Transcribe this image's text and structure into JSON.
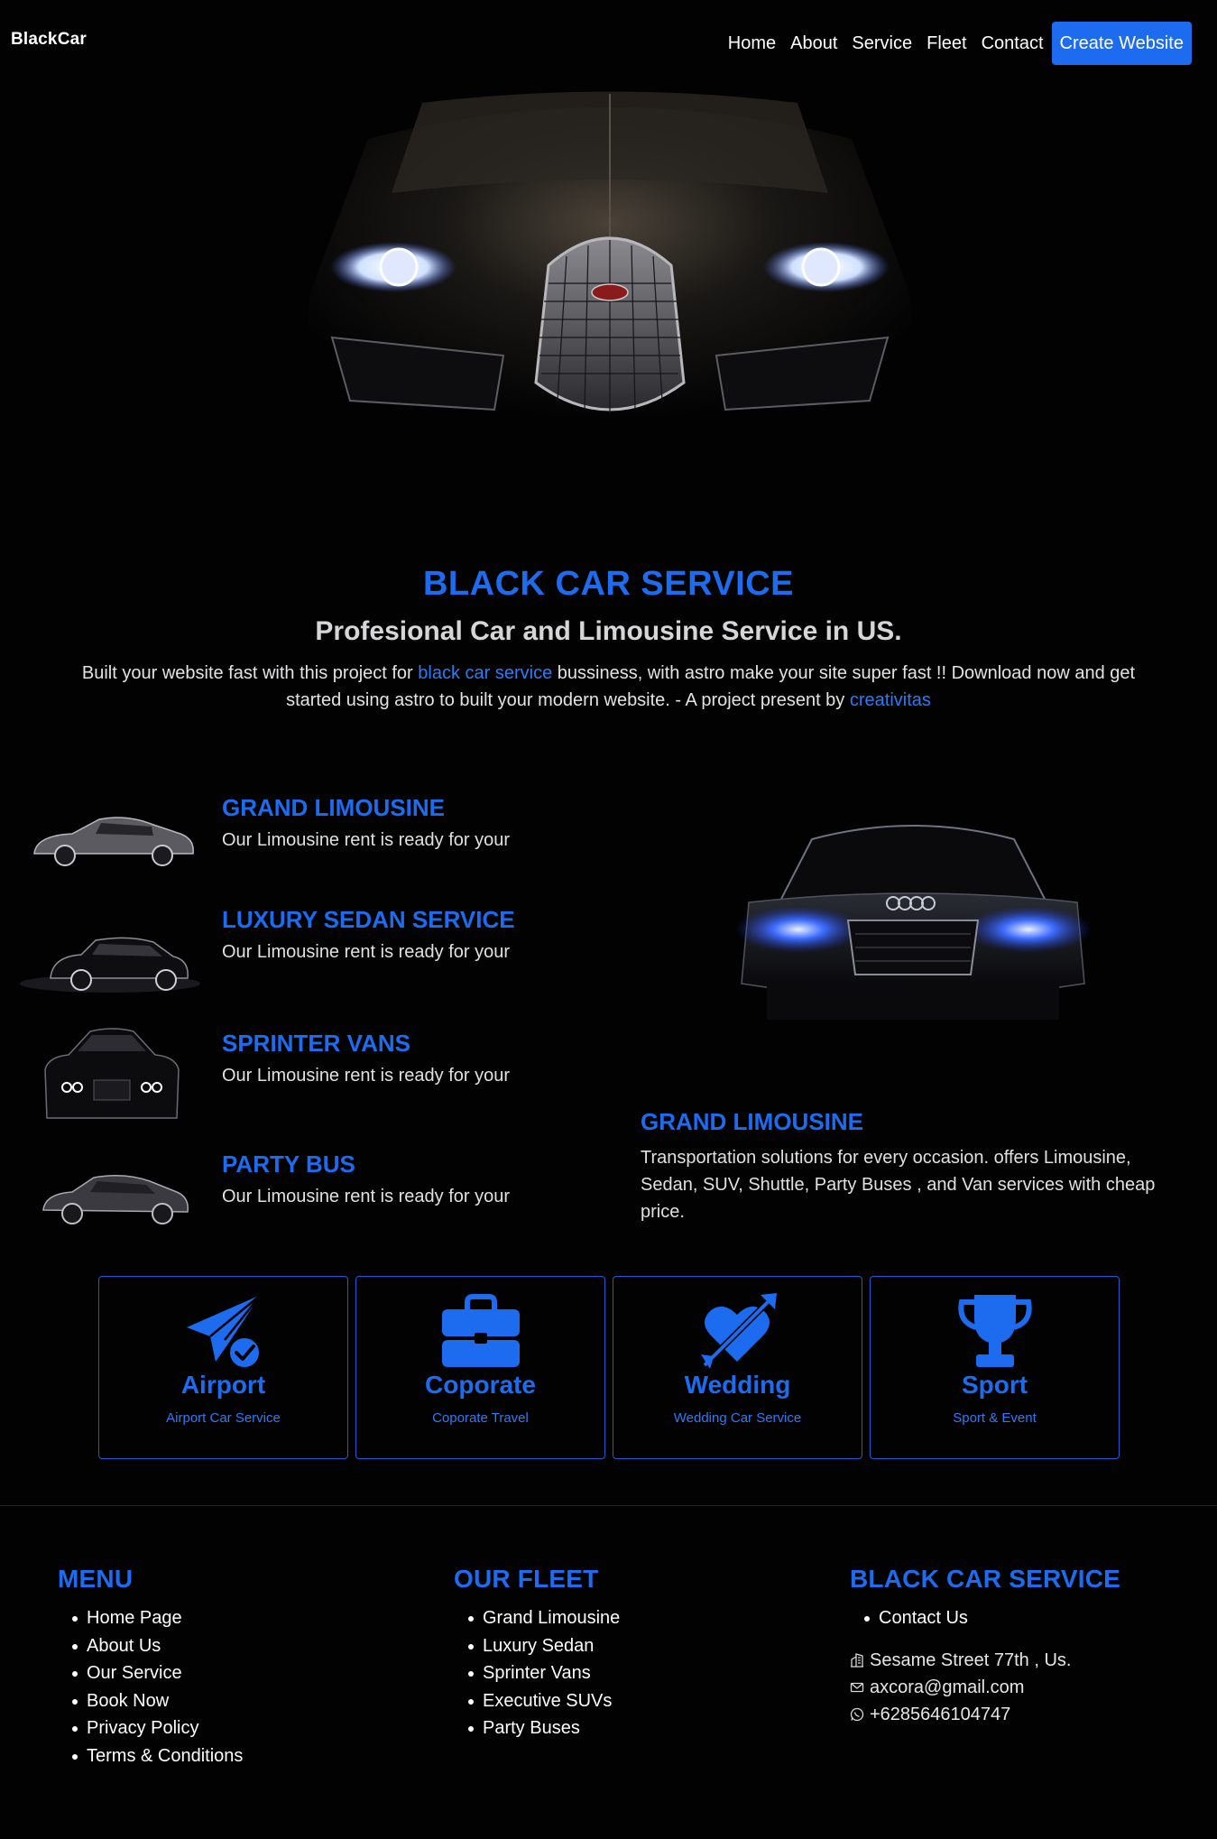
{
  "header": {
    "logo": "BlackCar",
    "nav": [
      "Home",
      "About",
      "Service",
      "Fleet",
      "Contact"
    ],
    "cta": "Create Website"
  },
  "hero": {
    "title": "BLACK CAR SERVICE",
    "subtitle": "Profesional Car and Limousine Service in US.",
    "desc_pre": "Built your website fast with this project for ",
    "desc_link1": "black car service",
    "desc_mid": " bussiness, with astro make your site super fast !! Download now and get started using astro to built your modern website. - A project present by ",
    "desc_link2": "creativitas"
  },
  "fleet": [
    {
      "title": "GRAND LIMOUSINE",
      "text": "Our Limousine rent is ready for your"
    },
    {
      "title": "LUXURY SEDAN SERVICE",
      "text": "Our Limousine rent is ready for your"
    },
    {
      "title": "SPRINTER VANS",
      "text": "Our Limousine rent is ready for your"
    },
    {
      "title": "PARTY BUS",
      "text": "Our Limousine rent is ready for your"
    }
  ],
  "feature": {
    "title": "GRAND LIMOUSINE",
    "text": "Transportation solutions for every occasion. offers Limousine, Sedan, SUV, Shuttle, Party Buses , and Van services with cheap price."
  },
  "services": [
    {
      "title": "Airport",
      "sub": "Airport Car Service",
      "icon": "paper-plane-check-icon"
    },
    {
      "title": "Coporate",
      "sub": "Coporate Travel",
      "icon": "briefcase-icon"
    },
    {
      "title": "Wedding",
      "sub": "Wedding Car Service",
      "icon": "heart-arrow-icon"
    },
    {
      "title": "Sport",
      "sub": "Sport & Event",
      "icon": "trophy-icon"
    }
  ],
  "footer": {
    "menu_title": "MENU",
    "menu": [
      "Home Page",
      "About Us",
      "Our Service",
      "Book Now",
      "Privacy Policy",
      "Terms & Conditions"
    ],
    "fleet_title": "OUR FLEET",
    "fleet": [
      "Grand Limousine",
      "Luxury Sedan",
      "Sprinter Vans",
      "Executive SUVs",
      "Party Buses"
    ],
    "company_title": "BLACK CAR SERVICE",
    "company": [
      "Contact Us"
    ],
    "address": "Sesame Street 77th , Us.",
    "email": "axcora@gmail.com",
    "phone": "+6285646104747"
  },
  "colors": {
    "accent": "#1d6cf0",
    "background": "#020203",
    "text": "#e8e8ea"
  }
}
